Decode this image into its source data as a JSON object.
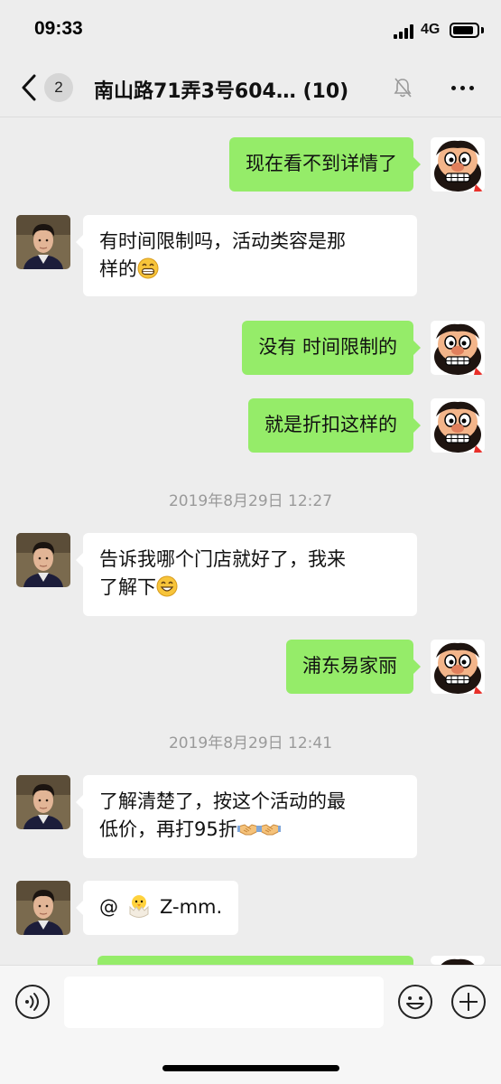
{
  "status_bar": {
    "time": "09:33",
    "network": "4G"
  },
  "nav": {
    "unread_count": "2",
    "title": "南山路71弄3号604…  (10)"
  },
  "messages": [
    {
      "type": "out",
      "text": "现在看不到详情了"
    },
    {
      "type": "in",
      "line1": "有时间限制吗，活动类容是那",
      "line2": "样的",
      "emoji": "grinning-face-emoji"
    },
    {
      "type": "out",
      "text": "没有 时间限制的"
    },
    {
      "type": "out",
      "text": "就是折扣这样的"
    },
    {
      "type": "time",
      "text": "2019年8月29日 12:27"
    },
    {
      "type": "in",
      "line1": "告诉我哪个门店就好了，我来",
      "line2": "了解下",
      "emoji": "smiling-face-emoji"
    },
    {
      "type": "out",
      "text": "浦东易家丽"
    },
    {
      "type": "time",
      "text": "2019年8月29日 12:41"
    },
    {
      "type": "in",
      "line1": "了解清楚了，按这个活动的最",
      "line2": "低价，再打95折",
      "emoji": "handshake-emoji"
    },
    {
      "type": "in",
      "prefix": "@",
      "emoji": "hatching-chick-emoji",
      "suffix": "Z-mm."
    }
  ],
  "input": {
    "placeholder": "",
    "value": ""
  },
  "colors": {
    "outgoing_bubble": "#95ec69",
    "incoming_bubble": "#ffffff",
    "background": "#ededed"
  }
}
